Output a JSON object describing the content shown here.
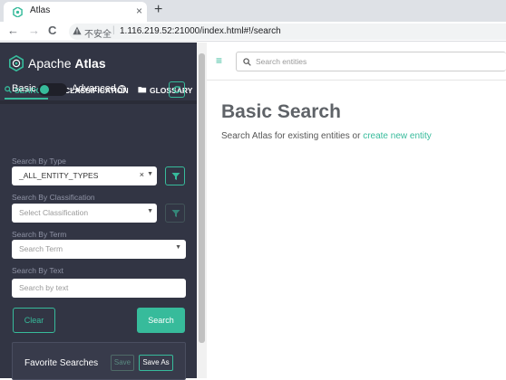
{
  "browser": {
    "tab_title": "Atlas",
    "tab_close": "×",
    "new_tab": "+",
    "security_label": "不安全",
    "url": "1.116.219.52:21000/index.html#!/search",
    "back": "←",
    "forward": "→",
    "reload": "C"
  },
  "sidebar": {
    "logo_word_1": "Apache",
    "logo_word_2": "Atlas",
    "tabs": [
      {
        "label": "SEARCH",
        "icon": "search-icon",
        "active": true
      },
      {
        "label": "CLASSIFICATION",
        "icon": "tag-icon",
        "active": false
      },
      {
        "label": "GLOSSARY",
        "icon": "folder-icon",
        "active": false
      }
    ],
    "toggle": {
      "left_label": "Basic",
      "right_label": "Advanced",
      "help": "?"
    },
    "search_by_type": {
      "label": "Search By Type",
      "value": "_ALL_ENTITY_TYPES",
      "clear": "×"
    },
    "search_by_classification": {
      "label": "Search By Classification",
      "placeholder": "Select Classification"
    },
    "search_by_term": {
      "label": "Search By Term",
      "placeholder": "Search Term"
    },
    "search_by_text": {
      "label": "Search By Text",
      "placeholder": "Search by text"
    },
    "clear_button": "Clear",
    "search_button": "Search",
    "favorites": {
      "title": "Favorite Searches",
      "save": "Save",
      "save_as": "Save As"
    }
  },
  "main": {
    "search_placeholder": "Search entities",
    "title": "Basic Search",
    "subtitle_prefix": "Search Atlas for existing entities or ",
    "subtitle_link": "create new entity"
  },
  "colors": {
    "accent": "#37bb9b",
    "sidebar_bg": "#323544"
  }
}
